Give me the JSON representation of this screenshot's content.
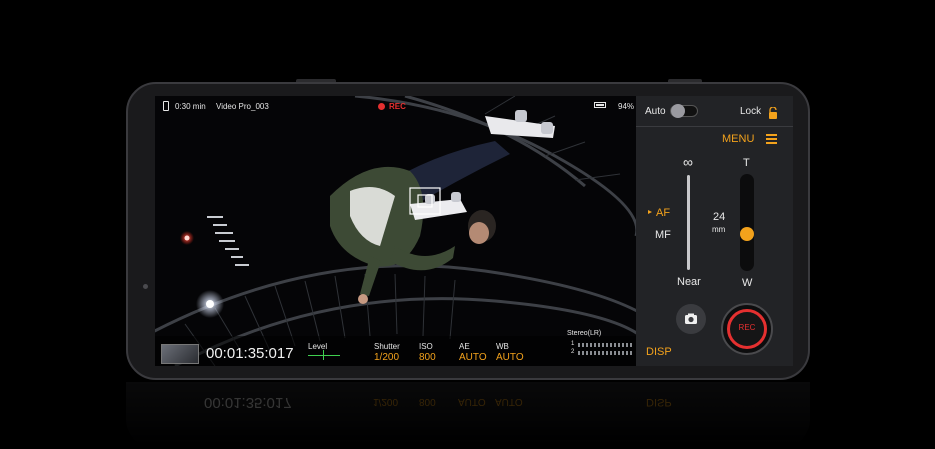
{
  "status_bar": {
    "duration": "0:30 min",
    "filename": "Video Pro_003",
    "rec": "REC",
    "battery_percent": "94%",
    "battery_level": 0.94
  },
  "viewfinder": {
    "timecode": "00:01:35:017",
    "level_label": "Level",
    "shutter_label": "Shutter",
    "shutter_value": "1/200",
    "iso_label": "ISO",
    "iso_value": "800",
    "ae_label": "AE",
    "ae_value": "AUTO",
    "wb_label": "WB",
    "wb_value": "AUTO",
    "audio_label": "Stereo(LR)",
    "audio_ch1": "1",
    "audio_ch2": "2"
  },
  "control_panel": {
    "auto_label": "Auto",
    "lock_label": "Lock",
    "menu_label": "MENU",
    "infinity_symbol": "∞",
    "near_label": "Near",
    "tele_label": "T",
    "wide_label": "W",
    "af_label": "AF",
    "mf_label": "MF",
    "focal_value": "24",
    "focal_unit": "mm",
    "disp_label": "DISP",
    "rec_label": "REC",
    "zoom_position": 0.36
  },
  "colors": {
    "accent": "#f3a21c",
    "record": "#e53030",
    "panel_bg": "#222326"
  }
}
